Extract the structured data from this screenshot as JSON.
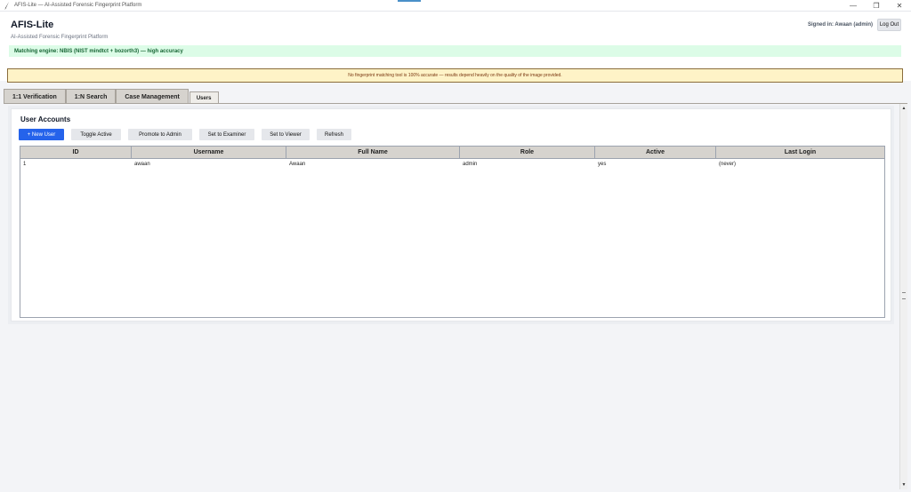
{
  "window": {
    "title": "AFIS-Lite — AI-Assisted Forensic Fingerprint Platform",
    "minimize": "—",
    "restore": "❐",
    "close": "✕"
  },
  "header": {
    "app_name": "AFIS-Lite",
    "subtitle": "AI-Assisted Forensic Fingerprint Platform",
    "signed_in": "Signed in: Awaan (admin)",
    "logout_label": "Log Out",
    "engine": "Matching engine: NBIS (NIST mindtct + bozorth3) — high accuracy"
  },
  "warning": "No fingerprint matching tool is 100% accurate — results depend heavily on the quality of the image provided.",
  "tabs": [
    {
      "label": "1:1 Verification"
    },
    {
      "label": "1:N Search"
    },
    {
      "label": "Case Management"
    },
    {
      "label": "Users"
    }
  ],
  "active_tab": "Users",
  "users_panel": {
    "title": "User Accounts",
    "buttons": {
      "new_user": "+ New User",
      "toggle_active": "Toggle Active",
      "promote": "Promote to Admin",
      "examiner": "Set to Examiner",
      "viewer": "Set to Viewer",
      "refresh": "Refresh"
    },
    "columns": [
      "ID",
      "Username",
      "Full Name",
      "Role",
      "Active",
      "Last Login"
    ],
    "rows": [
      [
        "1",
        "awaan",
        "Awaan",
        "admin",
        "yes",
        "(never)"
      ]
    ]
  },
  "colors": {
    "primary": "#2563eb",
    "success_bg": "#dcfce7",
    "success_text": "#166534",
    "warning_bg": "#fef3c7"
  }
}
